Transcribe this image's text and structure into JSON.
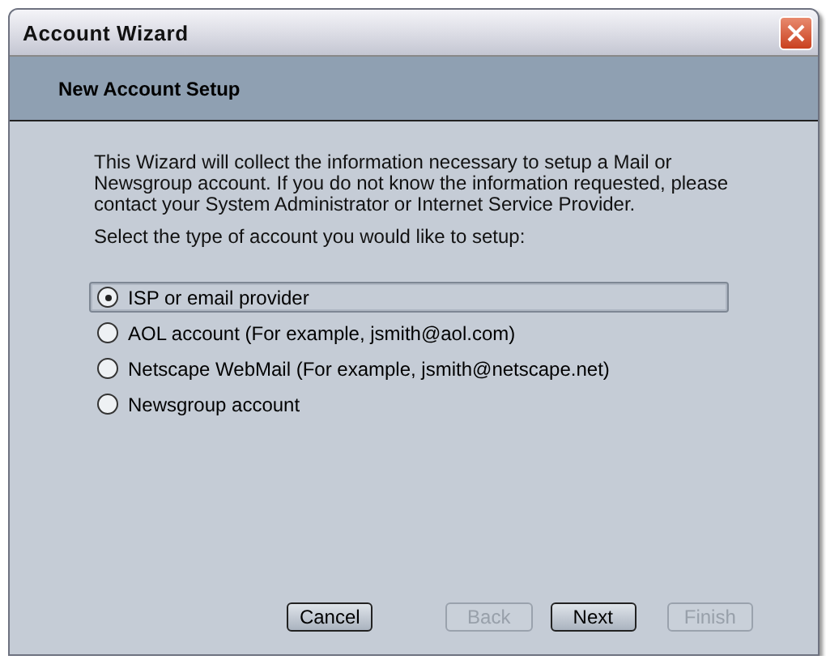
{
  "window": {
    "title": "Account Wizard"
  },
  "header": {
    "title": "New Account Setup"
  },
  "intro": "This Wizard will collect the information necessary to setup a Mail or Newsgroup account. If you do not know the information requested, please contact your System Administrator or Internet Service Provider.",
  "prompt": "Select the type of account you would like to setup:",
  "options": [
    {
      "label": "ISP or email provider",
      "selected": true
    },
    {
      "label": "AOL account (For example, jsmith@aol.com)",
      "selected": false
    },
    {
      "label": "Netscape WebMail (For example, jsmith@netscape.net)",
      "selected": false
    },
    {
      "label": "Newsgroup account",
      "selected": false
    }
  ],
  "buttons": [
    {
      "label": "Cancel",
      "disabled": false
    },
    {
      "label": "Back",
      "disabled": true
    },
    {
      "label": "Next",
      "disabled": false
    },
    {
      "label": "Finish",
      "disabled": true
    }
  ]
}
